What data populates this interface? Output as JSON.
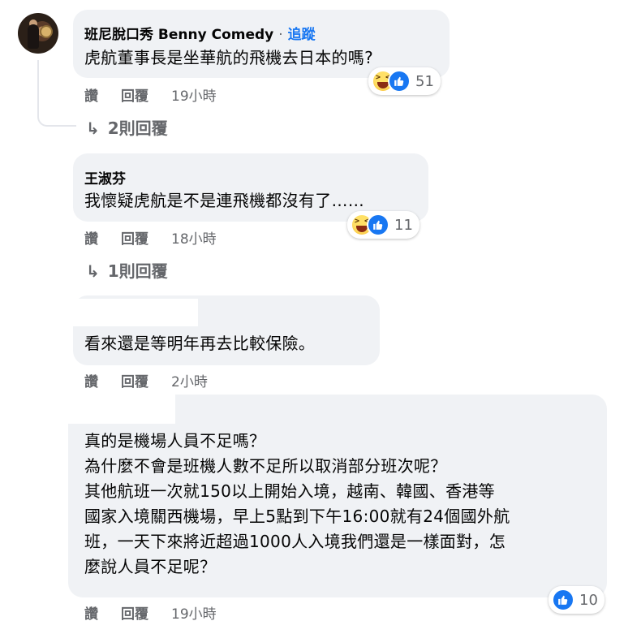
{
  "comments": [
    {
      "author": "班尼脫口秀 Benny Comedy",
      "follow_label": "追蹤",
      "separator": "·",
      "text": "虎航董事長是坐華航的飛機去日本的嗎?",
      "reactions": {
        "icons": [
          "haha-icon",
          "like-icon"
        ],
        "count": "51"
      },
      "actions": {
        "like": "讚",
        "reply": "回覆",
        "time": "19小時"
      },
      "replies_link": "2則回覆"
    },
    {
      "author": "王淑芬",
      "text": "我懷疑虎航是不是連飛機都沒有了……",
      "reactions": {
        "icons": [
          "haha-icon",
          "like-icon"
        ],
        "count": "11"
      },
      "actions": {
        "like": "讚",
        "reply": "回覆",
        "time": "18小時"
      },
      "replies_link": "1則回覆"
    },
    {
      "author": "",
      "text": "看來還是等明年再去比較保險。",
      "actions": {
        "like": "讚",
        "reply": "回覆",
        "time": "2小時"
      }
    },
    {
      "author": "",
      "text": "真的是機場人員不足嗎？\n為什麼不會是班機人數不足所以取消部分班次呢？\n其他航班一次就150以上開始入境，越南、韓國、香港等\n國家入境關西機場，早上5點到下午16:00就有24個國外航\n班，一天下來將近超過1000人入境我們還是一樣面對，怎\n麼說人員不足呢？",
      "reactions": {
        "icons": [
          "like-icon"
        ],
        "count": "10"
      },
      "actions": {
        "like": "讚",
        "reply": "回覆",
        "time": "19小時"
      }
    }
  ],
  "colors": {
    "bubble": "#f0f2f5",
    "link": "#1877f2",
    "meta": "#65676b",
    "text": "#050505"
  }
}
